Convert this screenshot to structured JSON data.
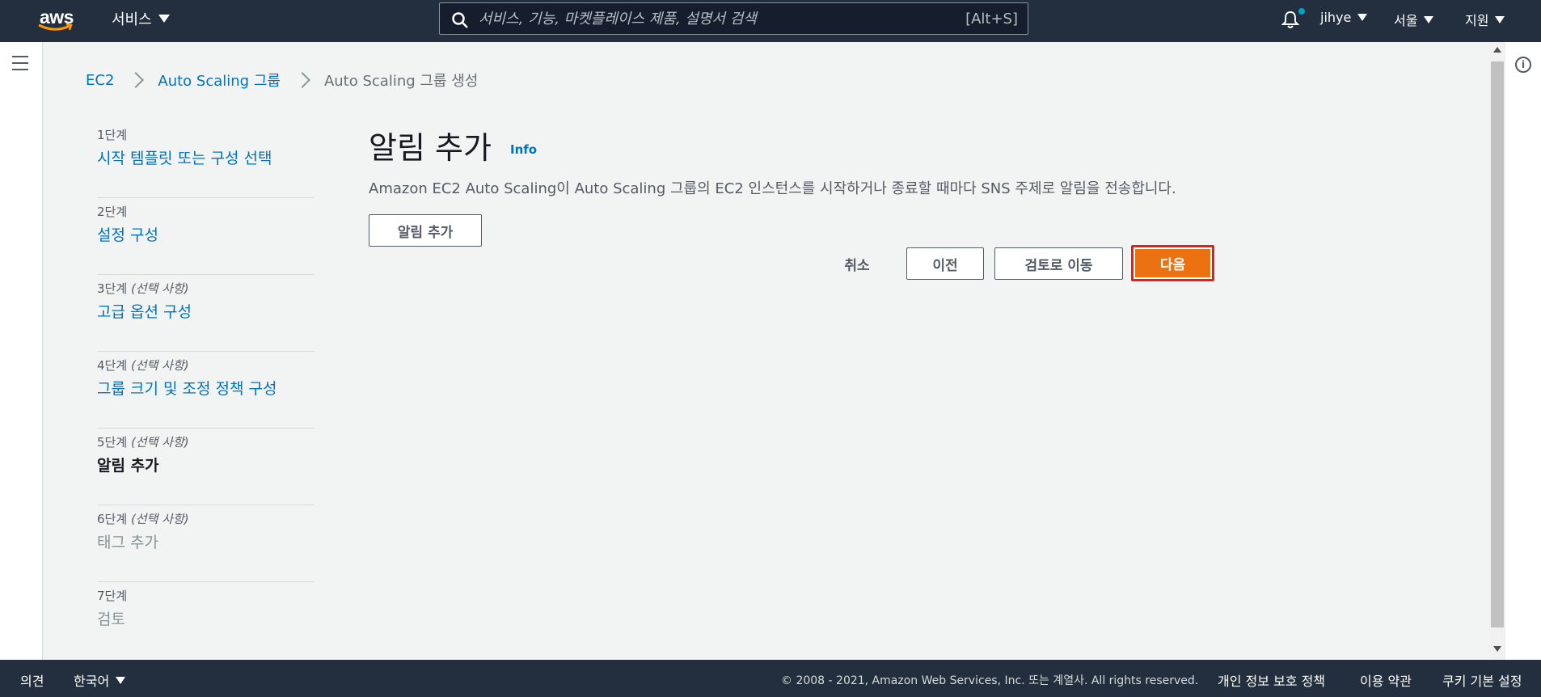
{
  "topnav": {
    "logo_text": "aws",
    "services_label": "서비스",
    "search_placeholder": "서비스, 기능, 마켓플레이스 제품, 설명서 검색",
    "search_shortcut": "[Alt+S]",
    "user": "jihye",
    "region": "서울",
    "support": "지원",
    "brand_color": "#232f3e",
    "accent_color": "#ec7211"
  },
  "breadcrumb": {
    "items": [
      "EC2",
      "Auto Scaling 그룹",
      "Auto Scaling 그룹 생성"
    ]
  },
  "steps": [
    {
      "label": "1단계",
      "optional": "",
      "title": "시작 템플릿 또는 구성 선택",
      "state": "link"
    },
    {
      "label": "2단계",
      "optional": "",
      "title": "설정 구성",
      "state": "link"
    },
    {
      "label": "3단계",
      "optional": "(선택 사항)",
      "title": "고급 옵션 구성",
      "state": "link"
    },
    {
      "label": "4단계",
      "optional": "(선택 사항)",
      "title": "그룹 크기 및 조정 정책 구성",
      "state": "link"
    },
    {
      "label": "5단계",
      "optional": "(선택 사항)",
      "title": "알림 추가",
      "state": "active"
    },
    {
      "label": "6단계",
      "optional": "(선택 사항)",
      "title": "태그 추가",
      "state": "disabled"
    },
    {
      "label": "7단계",
      "optional": "",
      "title": "검토",
      "state": "disabled"
    }
  ],
  "main": {
    "title": "알림 추가",
    "info_link": "Info",
    "description": "Amazon EC2 Auto Scaling이 Auto Scaling 그룹의 EC2 인스턴스를 시작하거나 종료할 때마다 SNS 주제로 알림을 전송합니다.",
    "add_notification_button": "알림 추가",
    "cancel_button": "취소",
    "previous_button": "이전",
    "skip_to_review_button": "검토로 이동",
    "next_button": "다음"
  },
  "footer": {
    "feedback": "의견",
    "language": "한국어",
    "copyright": "© 2008 - 2021, Amazon Web Services, Inc. 또는 계열사. All rights reserved.",
    "privacy": "개인 정보 보호 정책",
    "terms": "이용 약관",
    "cookies": "쿠키 기본 설정"
  }
}
